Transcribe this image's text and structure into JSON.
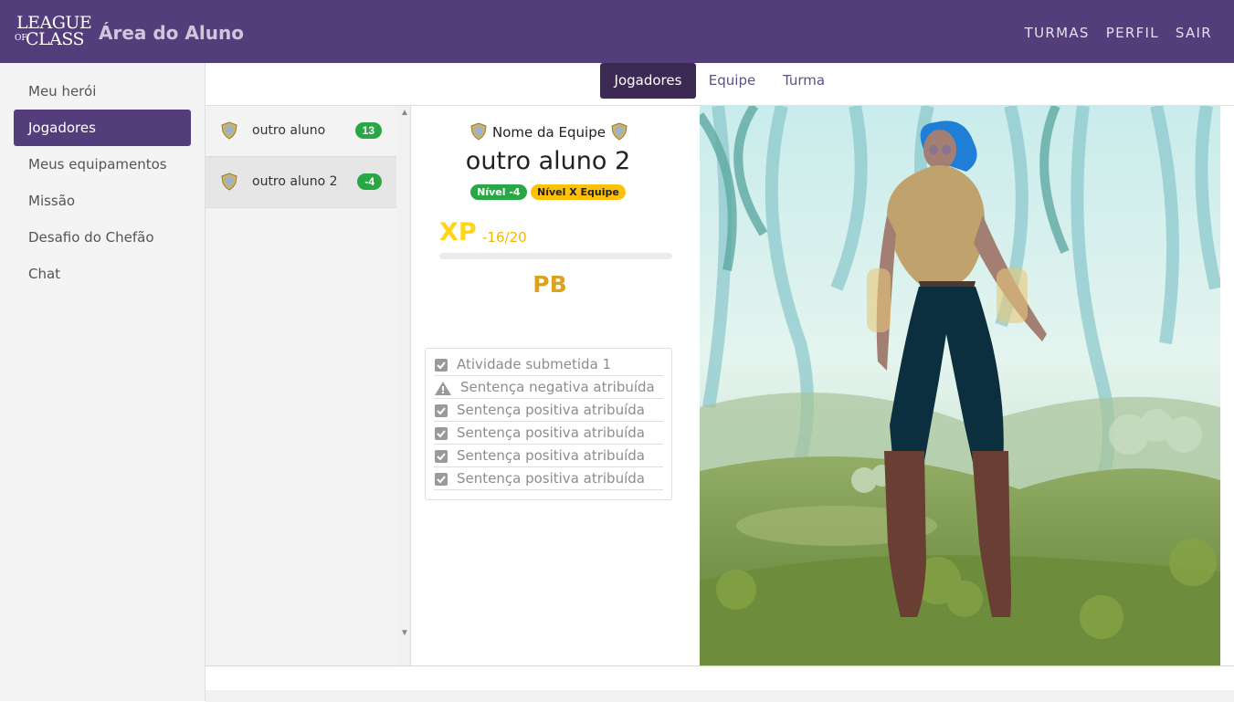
{
  "header": {
    "logo": {
      "line1": "LEAGUE",
      "line2": "OF",
      "line3": "CLASS"
    },
    "title": "Área do Aluno",
    "nav": [
      "TURMAS",
      "PERFIL",
      "SAIR"
    ]
  },
  "sidebar": {
    "items": [
      {
        "label": "Meu herói",
        "active": false
      },
      {
        "label": "Jogadores",
        "active": true
      },
      {
        "label": "Meus equipamentos",
        "active": false
      },
      {
        "label": "Missão",
        "active": false
      },
      {
        "label": "Desafio do Chefão",
        "active": false
      },
      {
        "label": "Chat",
        "active": false
      }
    ]
  },
  "tabs": [
    {
      "label": "Jogadores",
      "active": true
    },
    {
      "label": "Equipe",
      "active": false
    },
    {
      "label": "Turma",
      "active": false
    }
  ],
  "players": [
    {
      "name": "outro aluno",
      "badge": "13",
      "selected": false
    },
    {
      "name": "outro aluno 2",
      "badge": "-4",
      "selected": true
    }
  ],
  "detail": {
    "team_name": "Nome da Equipe",
    "hero_name": "outro aluno 2",
    "level_pill": "Nível -4",
    "team_level_pill": "Nível X Equipe",
    "xp_label": "XP",
    "xp_value": "-16/20",
    "pb_label": "PB",
    "activities": [
      {
        "text": "Atividade submetida 1",
        "icon": "check-square-icon"
      },
      {
        "text": "Sentença negativa atribuída",
        "icon": "warning-icon"
      },
      {
        "text": "Sentença positiva atribuída",
        "icon": "check-square-icon"
      },
      {
        "text": "Sentença positiva atribuída",
        "icon": "check-square-icon"
      },
      {
        "text": "Sentença positiva atribuída",
        "icon": "check-square-icon"
      },
      {
        "text": "Sentença positiva atribuída",
        "icon": "check-square-icon"
      }
    ]
  },
  "colors": {
    "brand": "#543d7b",
    "active_tab": "#3c2a55",
    "success": "#28a745",
    "warning": "#ffc107",
    "xp": "#ffd419",
    "pb": "#dca11d"
  }
}
